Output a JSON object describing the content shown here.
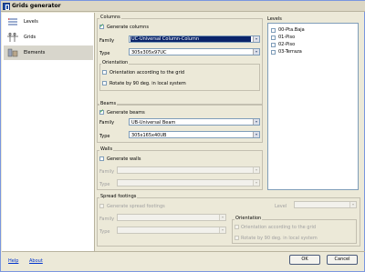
{
  "window": {
    "title": "Grids generator"
  },
  "sidebar": {
    "items": [
      {
        "label": "Levels",
        "icon": "levels-icon"
      },
      {
        "label": "Grids",
        "icon": "grids-icon"
      },
      {
        "label": "Elements",
        "icon": "elements-icon"
      }
    ],
    "active": "Elements"
  },
  "columns": {
    "legend": "Columns",
    "generate_label": "Generate columns",
    "family_label": "Family",
    "family_value": "UC-Universal Column-Column",
    "type_label": "Type",
    "type_value": "305x305x97UC",
    "orientation": {
      "legend": "Orientation",
      "according_label": "Orientation according to the grid",
      "rotate_label": "Rotate by 90 deg. in local system"
    }
  },
  "beams": {
    "legend": "Beams",
    "generate_label": "Generate beams",
    "family_label": "Family",
    "family_value": "UB-Universal Beam",
    "type_label": "Type",
    "type_value": "305x165x40UB"
  },
  "walls": {
    "legend": "Walls",
    "generate_label": "Generate walls",
    "family_label": "Family",
    "type_label": "Type"
  },
  "spread_footings": {
    "legend": "Spread footings",
    "generate_label": "Generate spread footings",
    "family_label": "Family",
    "type_label": "Type",
    "level_label": "Level",
    "orientation": {
      "legend": "Orientation",
      "according_label": "Orientation according to the grid",
      "rotate_label": "Rotate by 90 deg. in local system"
    }
  },
  "levels": {
    "label": "Levels",
    "items": [
      "00-Pta.Baja",
      "01-Piso",
      "02-Piso",
      "03-Terraza"
    ]
  },
  "footer": {
    "help": "Help",
    "about": "About",
    "ok": "OK",
    "cancel": "Cancel"
  },
  "colors": {
    "selection": "#0a246a",
    "link": "#0033cc",
    "check": "#21a121"
  }
}
